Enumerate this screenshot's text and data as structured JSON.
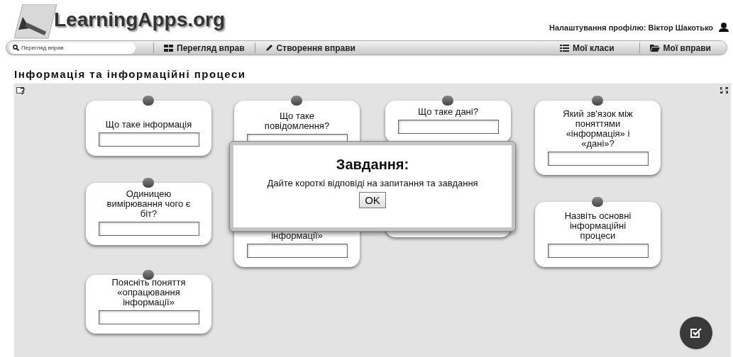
{
  "header": {
    "logo": "LearningApps.org",
    "profile": "Налаштування профілю: Віктор Шакотько"
  },
  "nav": {
    "search": {
      "placeholder": "Перегляд вправ"
    },
    "items": [
      {
        "label": "Перегляд вправ",
        "kind": "grid"
      },
      {
        "label": "Створення вправи",
        "kind": "pencil"
      },
      {
        "label": "Мої класи",
        "kind": "list"
      },
      {
        "label": "Мої вправи",
        "kind": "folder"
      }
    ]
  },
  "title": "Інформація та інформаційні процеси",
  "cards": [
    {
      "question": "Що таке інформація"
    },
    {
      "question": "Що таке повідомлення?"
    },
    {
      "question": "Що таке дані?"
    },
    {
      "question": "Який зв'язок між поняттями «інформація» і «дані»?"
    },
    {
      "question": "Одиницею вимірювання чого є біт?"
    },
    {
      "question": "інформації»"
    },
    {
      "question": "Назвіть основні інформаційні процеси"
    },
    {
      "question": "Поясніть поняття «опрацювання інформації»"
    }
  ],
  "dialog": {
    "title": "Завдання:",
    "message": "Дайте короткі відповіді на запитання та завдання",
    "button": "OK"
  }
}
